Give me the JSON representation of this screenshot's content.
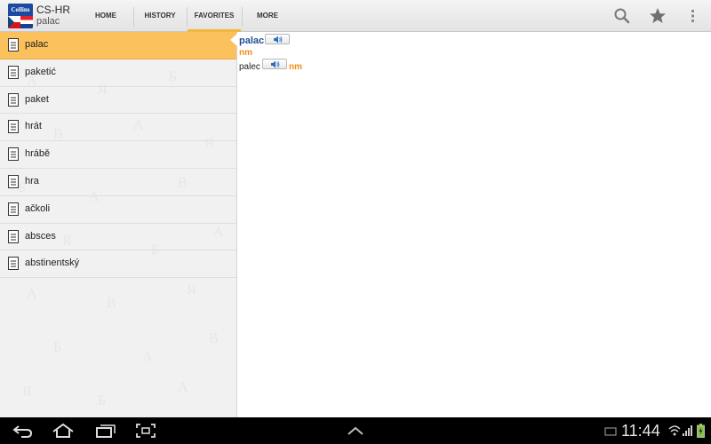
{
  "app": {
    "logo_text": "Collins",
    "title": "CS-HR",
    "subtitle": "palac"
  },
  "tabs": [
    {
      "label": "HOME",
      "selected": false
    },
    {
      "label": "HISTORY",
      "selected": false
    },
    {
      "label": "FAVORITES",
      "selected": true
    },
    {
      "label": "MORE",
      "selected": false
    }
  ],
  "actions": {
    "search_icon": "search-icon",
    "star_icon": "star-icon",
    "overflow_icon": "overflow-menu-icon"
  },
  "word_list": {
    "items": [
      {
        "label": "palac",
        "selected": true
      },
      {
        "label": "paketić",
        "selected": false
      },
      {
        "label": "paket",
        "selected": false
      },
      {
        "label": "hrát",
        "selected": false
      },
      {
        "label": "hrábě",
        "selected": false
      },
      {
        "label": "hra",
        "selected": false
      },
      {
        "label": "ačkoli",
        "selected": false
      },
      {
        "label": "absces",
        "selected": false
      },
      {
        "label": "abstinentský",
        "selected": false
      }
    ]
  },
  "entry": {
    "headword": "palac",
    "pos": "nm",
    "translation": "palec",
    "translation_pos": "nm"
  },
  "status_bar": {
    "time": "11:44"
  },
  "colors": {
    "accent": "#fbc15c",
    "headword": "#1f4e96",
    "pos": "#f08f17"
  }
}
